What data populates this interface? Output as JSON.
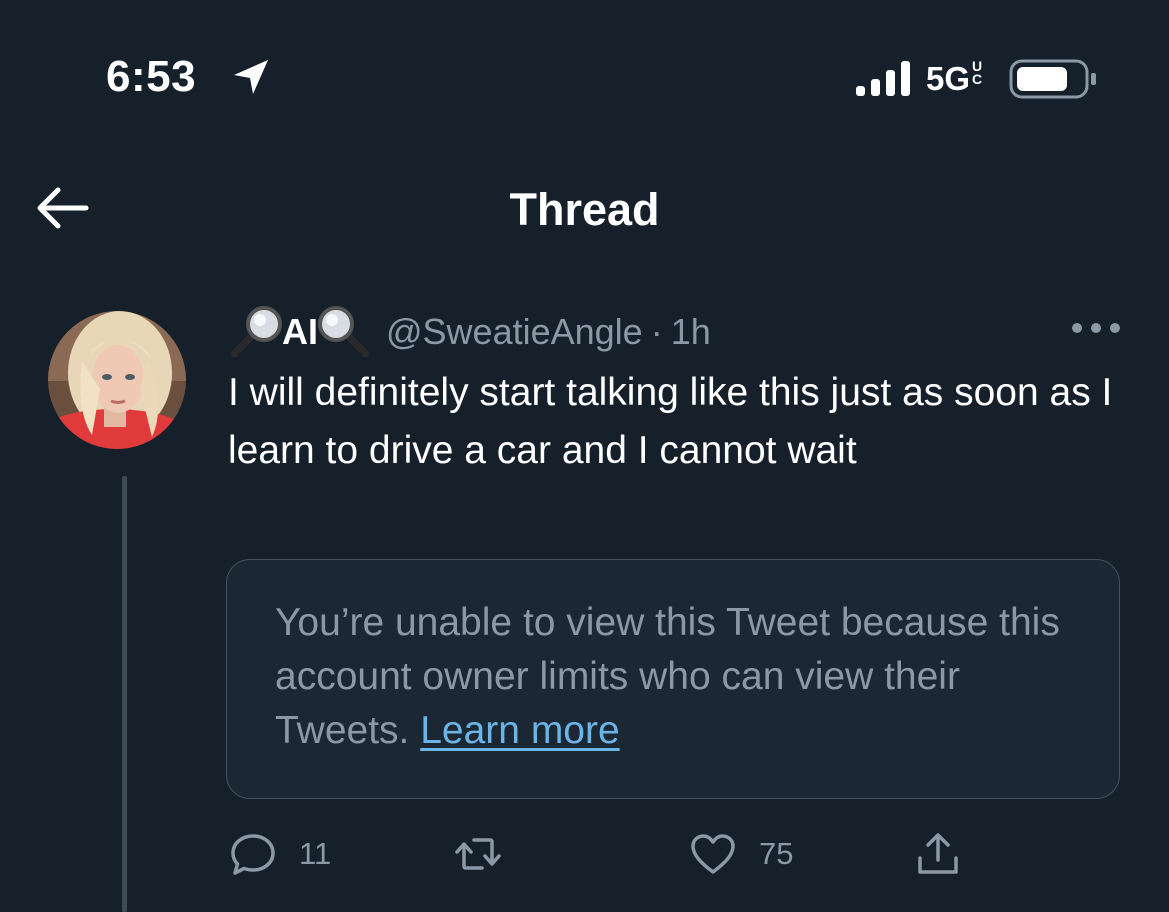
{
  "status_bar": {
    "time": "6:53",
    "network": "5G",
    "network_suffix": "UC"
  },
  "nav": {
    "title": "Thread"
  },
  "tweet": {
    "display_name": "AI",
    "display_name_emoji": "magnifying-glass-icon",
    "handle": "@SweatieAngle",
    "separator": "·",
    "timestamp": "1h",
    "text": "I will definitely start talking like this just as soon as I learn to drive a car and I cannot wait",
    "quoted_unavailable": {
      "message": "You’re unable to view this Tweet because this account owner limits who can view their Tweets.",
      "link_label": "Learn more"
    },
    "actions": {
      "reply_count": "11",
      "retweet_count": "",
      "like_count": "75"
    }
  },
  "colors": {
    "background": "#15202b",
    "secondary_text": "#8b98a5",
    "link": "#6ab4e8",
    "card_border": "#425261"
  }
}
